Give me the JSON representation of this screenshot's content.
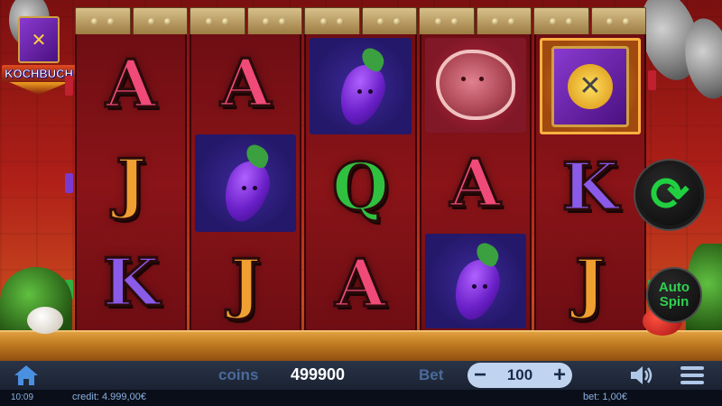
{
  "game": {
    "logo_title": "KOCHBUCH"
  },
  "reels": [
    [
      {
        "symbol": "A",
        "bg": "none"
      },
      {
        "symbol": "J",
        "bg": "none"
      },
      {
        "symbol": "K",
        "bg": "none"
      }
    ],
    [
      {
        "symbol": "A",
        "bg": "none"
      },
      {
        "symbol": "eggplant",
        "bg": "blue"
      },
      {
        "symbol": "J",
        "bg": "none"
      }
    ],
    [
      {
        "symbol": "eggplant",
        "bg": "blue"
      },
      {
        "symbol": "Q",
        "bg": "none"
      },
      {
        "symbol": "A",
        "bg": "none"
      }
    ],
    [
      {
        "symbol": "steak",
        "bg": "red"
      },
      {
        "symbol": "A",
        "bg": "none"
      },
      {
        "symbol": "eggplant",
        "bg": "blue"
      }
    ],
    [
      {
        "symbol": "book",
        "bg": "gold"
      },
      {
        "symbol": "K",
        "bg": "none"
      },
      {
        "symbol": "J",
        "bg": "none"
      }
    ]
  ],
  "controls": {
    "spin_icon": "refresh-arrows-icon",
    "auto_spin_label_1": "Auto",
    "auto_spin_label_2": "Spin",
    "coins_label": "coins",
    "coins_value": "499900",
    "bet_label": "Bet",
    "bet_minus": "−",
    "bet_value": "100",
    "bet_plus": "+"
  },
  "status": {
    "time": "10:09",
    "credit": "credit: 4.999,00€",
    "bet": "bet: 1,00€"
  },
  "colors": {
    "spin_green": "#20d040",
    "background_red": "#b02018"
  }
}
